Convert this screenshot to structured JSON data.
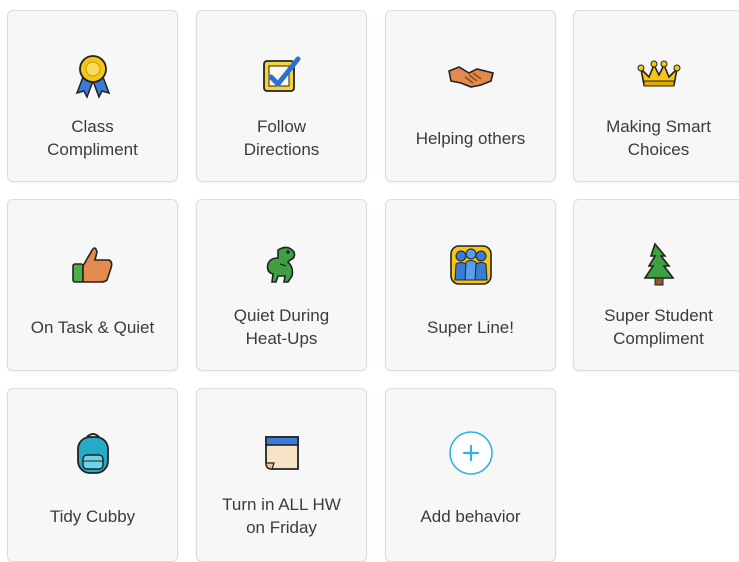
{
  "behaviors": [
    {
      "label": "Class\nCompliment",
      "icon": "award-ribbon-icon"
    },
    {
      "label": "Follow\nDirections",
      "icon": "checkbox-icon"
    },
    {
      "label": "Helping others",
      "icon": "handshake-icon"
    },
    {
      "label": "Making Smart\nChoices",
      "icon": "crown-icon"
    },
    {
      "label": "On Task & Quiet",
      "icon": "thumbs-up-icon"
    },
    {
      "label": "Quiet During\nHeat-Ups",
      "icon": "dinosaur-icon"
    },
    {
      "label": "Super Line!",
      "icon": "people-group-icon"
    },
    {
      "label": "Super Student\nCompliment",
      "icon": "tree-icon"
    },
    {
      "label": "Tidy Cubby",
      "icon": "backpack-icon"
    },
    {
      "label": "Turn in ALL HW\non Friday",
      "icon": "calendar-icon"
    }
  ],
  "add_behavior": {
    "label": "Add behavior",
    "icon": "plus-circle-icon"
  },
  "colors": {
    "accent": "#2fb4e0",
    "card_bg": "#f7f7f7",
    "text": "#3b3b3b"
  }
}
